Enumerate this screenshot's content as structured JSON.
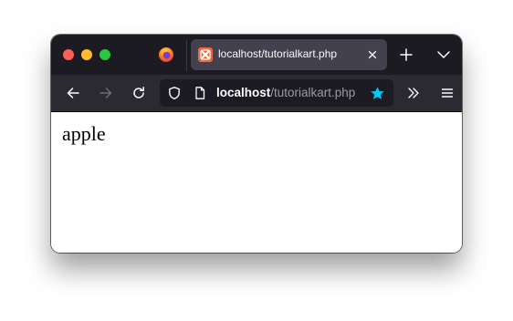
{
  "window": {
    "tab": {
      "title": "localhost/tutorialkart.php",
      "favicon": "xampp-icon"
    },
    "url": {
      "host": "localhost",
      "path": "/tutorialkart.php"
    },
    "colors": {
      "accent_star": "#00c8f5",
      "favicon": "#f0693c"
    }
  },
  "page": {
    "text": "apple"
  }
}
